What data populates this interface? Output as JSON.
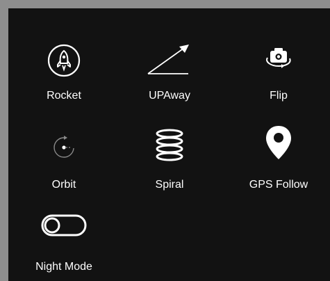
{
  "panel": {
    "background": "#121212",
    "items": [
      {
        "label": "Rocket",
        "icon": "rocket-icon",
        "selected": false
      },
      {
        "label": "UPAway",
        "icon": "up-away-arrow-icon",
        "selected": false
      },
      {
        "label": "Flip",
        "icon": "flip-camera-icon",
        "selected": false
      },
      {
        "label": "Orbit",
        "icon": "orbit-icon",
        "selected": false
      },
      {
        "label": "Spiral",
        "icon": "spiral-icon",
        "selected": false
      },
      {
        "label": "GPS Follow",
        "icon": "location-pin-icon",
        "selected": false
      },
      {
        "label": "Night Mode",
        "icon": "toggle-switch-icon",
        "toggle_on": false
      }
    ]
  }
}
